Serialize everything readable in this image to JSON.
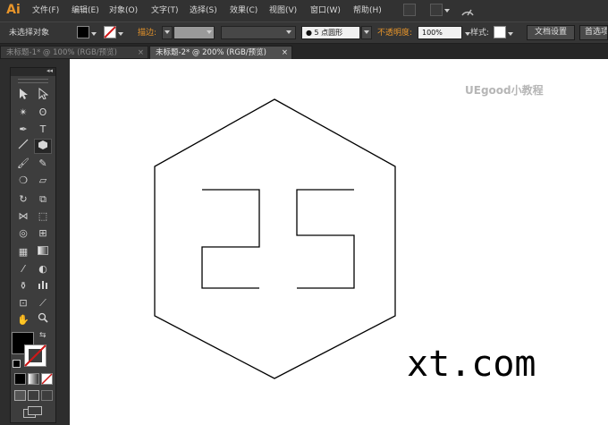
{
  "app": {
    "logo": "Ai"
  },
  "menu": {
    "items": [
      "文件(F)",
      "编辑(E)",
      "对象(O)",
      "文字(T)",
      "选择(S)",
      "效果(C)",
      "视图(V)",
      "窗口(W)",
      "帮助(H)"
    ]
  },
  "control_bar": {
    "selection_status": "未选择对象",
    "stroke_label": "描边:",
    "brush_label": "5 点圆形",
    "brush_dot": "●",
    "opacity_label": "不透明度:",
    "opacity_value": "100%",
    "style_label": "样式:",
    "doc_settings_button": "文档设置",
    "preferences_button": "首选项",
    "fill_color": "#000000",
    "stroke_color": "#ffffff"
  },
  "tabs": [
    {
      "label": "未标题-1* @ 100% (RGB/预览)",
      "close": "×",
      "active": false
    },
    {
      "label": "未标题-2* @ 200% (RGB/预览)",
      "close": "×",
      "active": true
    }
  ],
  "toolbox": {
    "collapse_label": "◂◂"
  },
  "canvas": {
    "watermark": "UEgood小教程",
    "caption": "xt.com",
    "stroke_color": "#000000"
  },
  "accent_color": "#e8952a"
}
